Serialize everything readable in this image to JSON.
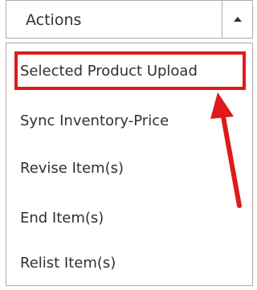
{
  "select": {
    "label": "Actions",
    "toggle_icon": "caret-up-icon"
  },
  "menu": {
    "items": [
      {
        "label": "Selected Product Upload",
        "highlighted": true
      },
      {
        "label": "Sync Inventory-Price"
      },
      {
        "label": "Revise Item(s)"
      },
      {
        "label": "End Item(s)"
      },
      {
        "label": "Relist Item(s)"
      }
    ]
  },
  "annotation": {
    "color": "#dd1b1b",
    "arrow_icon": "red-arrow-icon"
  }
}
